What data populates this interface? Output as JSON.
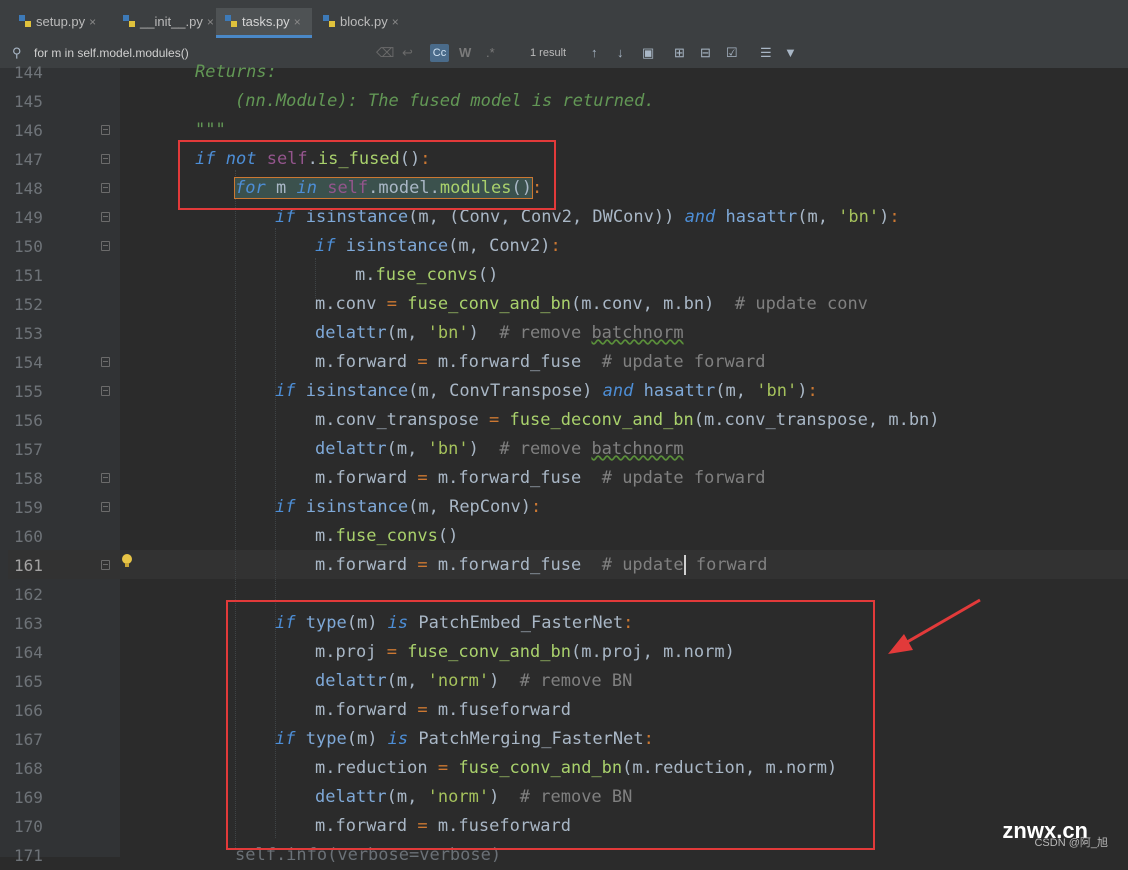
{
  "tabs": [
    {
      "label": "setup.py",
      "active": false
    },
    {
      "label": "__init__.py",
      "active": false
    },
    {
      "label": "tasks.py",
      "active": true
    },
    {
      "label": "block.py",
      "active": false
    }
  ],
  "tab_close_glyph": "×",
  "find": {
    "query": "for m in self.model.modules()",
    "match_case_label": "Cc",
    "words_label": "W",
    "regex_label": ".*",
    "result_count": "1 result"
  },
  "lines": [
    {
      "n": "144"
    },
    {
      "n": "145"
    },
    {
      "n": "146"
    },
    {
      "n": "147"
    },
    {
      "n": "148"
    },
    {
      "n": "149"
    },
    {
      "n": "150"
    },
    {
      "n": "151"
    },
    {
      "n": "152"
    },
    {
      "n": "153"
    },
    {
      "n": "154"
    },
    {
      "n": "155"
    },
    {
      "n": "156"
    },
    {
      "n": "157"
    },
    {
      "n": "158"
    },
    {
      "n": "159"
    },
    {
      "n": "160"
    },
    {
      "n": "161"
    },
    {
      "n": "162"
    },
    {
      "n": "163"
    },
    {
      "n": "164"
    },
    {
      "n": "165"
    },
    {
      "n": "166"
    },
    {
      "n": "167"
    },
    {
      "n": "168"
    },
    {
      "n": "169"
    },
    {
      "n": "170"
    },
    {
      "n": "171"
    }
  ],
  "code": {
    "l144": "Returns:",
    "l145": "(nn.Module): The fused model is returned.",
    "l146": "\"\"\"",
    "if": "if",
    "not": "not",
    "self": "self",
    "is_fused": "is_fused",
    "for": "for",
    "m": "m",
    "in": "in",
    "model": "model",
    "modules": "modules",
    "isinstance": "isinstance",
    "Conv": "Conv",
    "Conv2": "Conv2",
    "DWConv": "DWConv",
    "and": "and",
    "hasattr": "hasattr",
    "bn_str": "'bn'",
    "fuse_convs": "fuse_convs",
    "conv": "conv",
    "fuse_conv_and_bn": "fuse_conv_and_bn",
    "bn": "bn",
    "c_update_conv": "# update conv",
    "delattr": "delattr",
    "c_remove": "# remove ",
    "batchnorm": "batchnorm",
    "forward": "forward",
    "forward_fuse": "forward_fuse",
    "c_update_forward": "# update forward",
    "c_update": "# update",
    "c_forward": " forward",
    "ConvTranspose": "ConvTranspose",
    "conv_transpose": "conv_transpose",
    "fuse_deconv_and_bn": "fuse_deconv_and_bn",
    "RepConv": "RepConv",
    "type": "type",
    "is": "is",
    "PatchEmbed_FasterNet": "PatchEmbed_FasterNet",
    "proj": "proj",
    "norm": "norm",
    "norm_str": "'norm'",
    "c_remove_bn": "# remove BN",
    "fuseforward": "fuseforward",
    "PatchMerging_FasterNet": "PatchMerging_FasterNet",
    "reduction": "reduction",
    "l171": "self.info(verbose=verbose)"
  },
  "watermark": "znwx.cn",
  "watermark_sub": "CSDN @阿_旭",
  "colors": {
    "background": "#2b2b2b",
    "keyword": "#cc7832",
    "function": "#a9d16c",
    "string": "#a5c25c",
    "comment": "#808080",
    "annotation_red": "#e23a3a"
  }
}
